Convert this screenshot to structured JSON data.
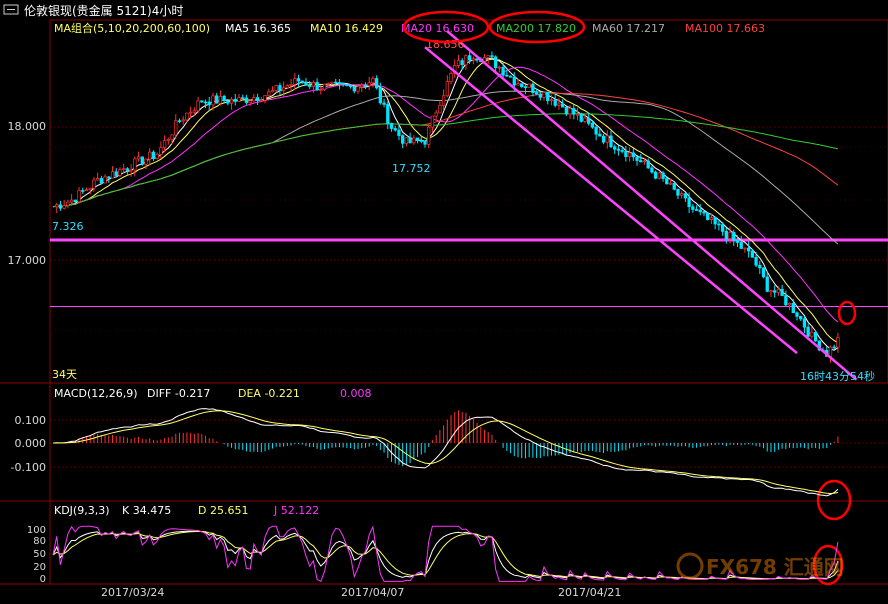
{
  "window": {
    "title": "伦敦银现(贵金属 5121)4小时",
    "icon": "chart-window-icon"
  },
  "colors": {
    "background": "#000000",
    "up_candle": "#ff3030",
    "down_candle": "#00e5ff",
    "grid": "#7a0000",
    "axis_text": "#d9d9d9",
    "ma5": "#ffffff",
    "ma10": "#ffff66",
    "ma20": "#ff33ff",
    "ma200": "#33cc33",
    "ma60": "#aaaaaa",
    "ma100": "#ff4040",
    "channel": "#ff44ff",
    "annotation_circle": "#ff0000"
  },
  "main_panel": {
    "ma_header": {
      "label": "MA组合(5,10,20,200,60,100)",
      "items": [
        {
          "name": "MA5",
          "value": "16.365"
        },
        {
          "name": "MA10",
          "value": "16.429"
        },
        {
          "name": "MA20",
          "value": "16.630"
        },
        {
          "name": "MA200",
          "value": "17.820"
        },
        {
          "name": "MA60",
          "value": "17.217"
        },
        {
          "name": "MA100",
          "value": "17.663"
        }
      ]
    },
    "y_ticks": [
      "18.000",
      "17.000"
    ],
    "annotations": {
      "left_low": "7.326",
      "mid_low": "17.752",
      "peak": "18.656",
      "period_left": "34天",
      "countdown": "16时43分54秒"
    }
  },
  "macd_panel": {
    "label": "MACD(12,26,9)",
    "diff_label": "DIFF",
    "diff_value": "-0.217",
    "dea_label": "DEA",
    "dea_value": "-0.221",
    "macd_value": "0.008",
    "y_ticks": [
      "0.100",
      "0.000",
      "-0.100"
    ]
  },
  "kdj_panel": {
    "label": "KDJ(9,3,3)",
    "k_label": "K",
    "k_value": "34.475",
    "d_label": "D",
    "d_value": "25.651",
    "j_label": "J",
    "j_value": "52.122",
    "y_ticks": [
      "100",
      "80",
      "50",
      "20",
      "0"
    ]
  },
  "x_axis": {
    "dates": [
      "2017/03/24",
      "2017/04/07",
      "2017/04/21"
    ]
  },
  "watermark": "FX678 汇通网",
  "chart_data": [
    {
      "type": "candlestick",
      "title": "伦敦银现(贵金属 5121)4小时",
      "ylim": [
        16.2,
        18.9
      ],
      "grid": true,
      "anchors": [
        [
          0,
          17.4
        ],
        [
          5,
          17.45
        ],
        [
          12,
          17.6
        ],
        [
          20,
          17.7
        ],
        [
          28,
          17.8
        ],
        [
          34,
          18.05
        ],
        [
          40,
          18.2
        ],
        [
          50,
          18.2
        ],
        [
          58,
          18.25
        ],
        [
          66,
          18.35
        ],
        [
          72,
          18.3
        ],
        [
          80,
          18.3
        ],
        [
          86,
          18.35
        ],
        [
          88,
          18.2
        ],
        [
          91,
          18.0
        ],
        [
          95,
          17.88
        ],
        [
          100,
          17.9
        ],
        [
          104,
          18.2
        ],
        [
          108,
          18.45
        ],
        [
          113,
          18.55
        ],
        [
          118,
          18.5
        ],
        [
          124,
          18.35
        ],
        [
          132,
          18.25
        ],
        [
          140,
          18.1
        ],
        [
          148,
          17.92
        ],
        [
          156,
          17.78
        ],
        [
          164,
          17.6
        ],
        [
          172,
          17.38
        ],
        [
          180,
          17.22
        ],
        [
          188,
          17.02
        ],
        [
          192,
          16.8
        ],
        [
          196,
          16.72
        ],
        [
          200,
          16.6
        ],
        [
          204,
          16.42
        ],
        [
          208,
          16.3
        ],
        [
          211,
          16.4
        ]
      ],
      "moving_averages": [
        {
          "name": "MA5",
          "last": 16.365
        },
        {
          "name": "MA10",
          "last": 16.429
        },
        {
          "name": "MA20",
          "last": 16.63
        },
        {
          "name": "MA200",
          "last": 17.82
        },
        {
          "name": "MA60",
          "last": 17.217
        },
        {
          "name": "MA100",
          "last": 17.663
        }
      ],
      "horizontal_lines": [
        17.15,
        16.65
      ],
      "channel": {
        "upper": [
          {
            "bar": 106,
            "price": 18.72
          },
          {
            "bar": 216,
            "price": 16.1
          }
        ],
        "lower": [
          {
            "bar": 100,
            "price": 18.6
          },
          {
            "bar": 200,
            "price": 16.3
          }
        ]
      }
    },
    {
      "type": "histogram+line",
      "title": "MACD(12,26,9)",
      "ylim": [
        -0.2,
        0.14
      ],
      "series": [
        {
          "name": "DIFF",
          "last": -0.217
        },
        {
          "name": "DEA",
          "last": -0.221
        },
        {
          "name": "MACD",
          "last": 0.008
        }
      ]
    },
    {
      "type": "line",
      "title": "KDJ(9,3,3)",
      "ylim": [
        0,
        100
      ],
      "series": [
        {
          "name": "K",
          "last": 34.475
        },
        {
          "name": "D",
          "last": 25.651
        },
        {
          "name": "J",
          "last": 52.122
        }
      ]
    }
  ]
}
